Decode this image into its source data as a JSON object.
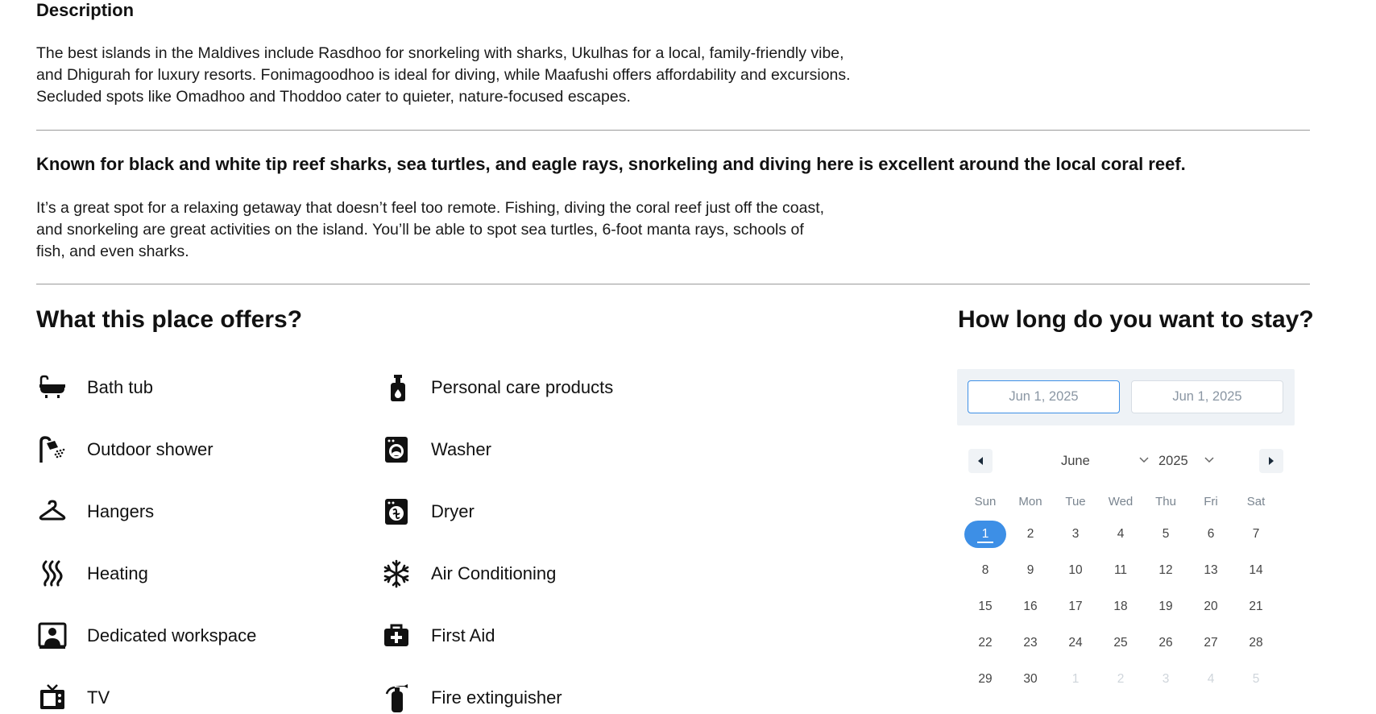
{
  "description": {
    "heading": "Description",
    "text": "The best islands in the Maldives include Rasdhoo for snorkeling with sharks, Ukulhas for a local, family-friendly vibe, and Dhigurah for luxury resorts. Fonimagoodhoo is ideal for diving, while Maafushi offers affordability and excursions. Secluded spots like Omadhoo and Thoddoo cater to quieter, nature-focused escapes."
  },
  "highlight": {
    "title": "Known for black and white tip reef sharks, sea turtles, and eagle rays, snorkeling and diving here is excellent around the local coral reef.",
    "text": "It’s a great spot for a relaxing getaway that doesn’t feel too remote. Fishing, diving the coral reef just off the coast, and snorkeling are great activities on the island. You’ll be able to spot sea turtles, 6-foot manta rays, schools of fish, and even sharks."
  },
  "offers": {
    "title": "What this place offers?",
    "items": [
      {
        "label": "Bath tub",
        "icon": "bathtub-icon"
      },
      {
        "label": "Outdoor shower",
        "icon": "shower-icon"
      },
      {
        "label": "Hangers",
        "icon": "hanger-icon"
      },
      {
        "label": "Heating",
        "icon": "heating-icon"
      },
      {
        "label": "Dedicated workspace",
        "icon": "workspace-icon"
      },
      {
        "label": "TV",
        "icon": "tv-icon"
      },
      {
        "label": "Personal care products",
        "icon": "soap-bottle-icon"
      },
      {
        "label": "Washer",
        "icon": "washer-icon"
      },
      {
        "label": "Dryer",
        "icon": "dryer-icon"
      },
      {
        "label": "Air Conditioning",
        "icon": "snowflake-icon"
      },
      {
        "label": "First Aid",
        "icon": "first-aid-icon"
      },
      {
        "label": "Fire extinguisher",
        "icon": "fire-extinguisher-icon"
      }
    ]
  },
  "stay": {
    "title": "How long do you want to stay?",
    "start_date": "Jun 1, 2025",
    "end_date": "Jun 1, 2025",
    "calendar": {
      "month": "June",
      "year": "2025",
      "weekdays": [
        "Sun",
        "Mon",
        "Tue",
        "Wed",
        "Thu",
        "Fri",
        "Sat"
      ],
      "weeks": [
        [
          "1",
          "2",
          "3",
          "4",
          "5",
          "6",
          "7"
        ],
        [
          "8",
          "9",
          "10",
          "11",
          "12",
          "13",
          "14"
        ],
        [
          "15",
          "16",
          "17",
          "18",
          "19",
          "20",
          "21"
        ],
        [
          "22",
          "23",
          "24",
          "25",
          "26",
          "27",
          "28"
        ],
        [
          "29",
          "30",
          "1",
          "2",
          "3",
          "4",
          "5"
        ]
      ],
      "selected_day": "1",
      "colors": {
        "accent": "#3d8fe6",
        "muted": "#cfd5db",
        "panel": "#eef2f6"
      }
    }
  }
}
